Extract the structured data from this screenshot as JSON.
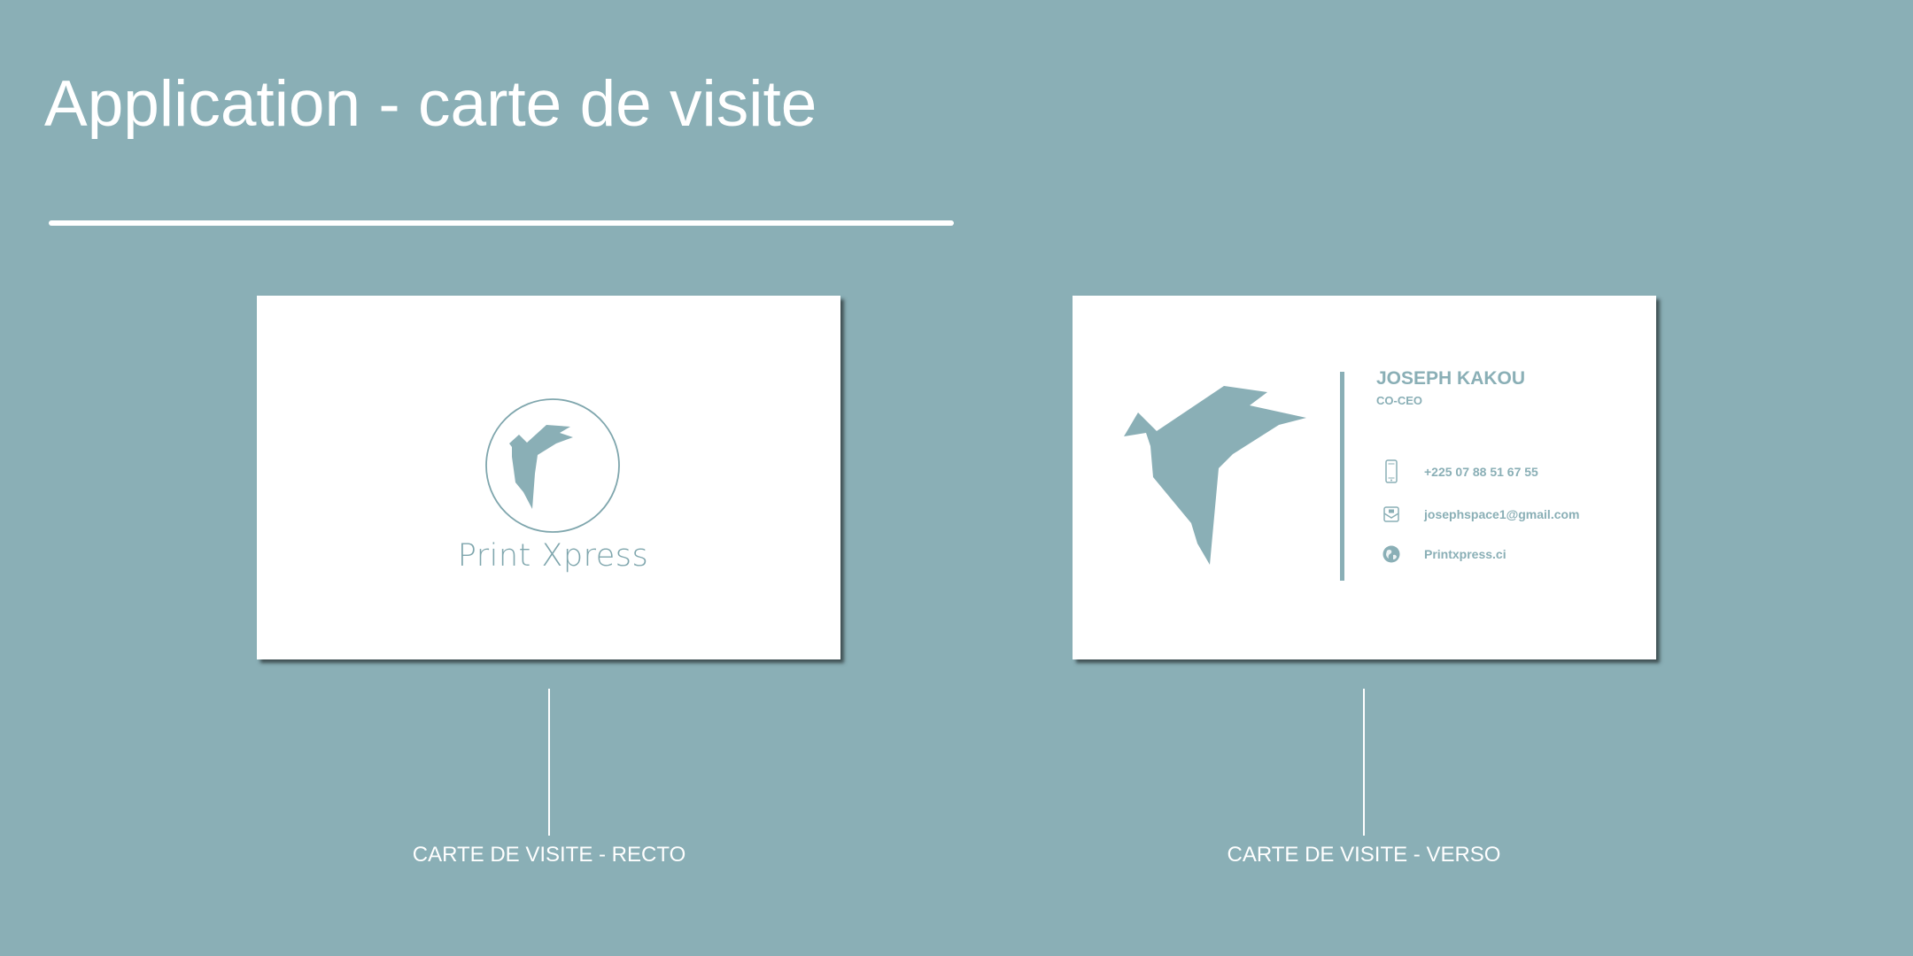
{
  "title": "Application - carte de visite",
  "colors": {
    "background": "#8aafb6",
    "accent": "#8aafb6",
    "card": "#ffffff"
  },
  "front": {
    "brand_name": "Print Xpress",
    "logo": "bird-in-circle-logo",
    "caption": "CARTE DE VISITE - RECTO"
  },
  "back": {
    "name": "JOSEPH KAKOU",
    "role": "CO-CEO",
    "phone": "+225 07 88 51 67 55",
    "email": "josephspace1@gmail.com",
    "website": "Printxpress.ci",
    "icons": [
      "phone-icon",
      "mail-icon",
      "globe-icon"
    ],
    "caption": "CARTE DE VISITE - VERSO"
  }
}
